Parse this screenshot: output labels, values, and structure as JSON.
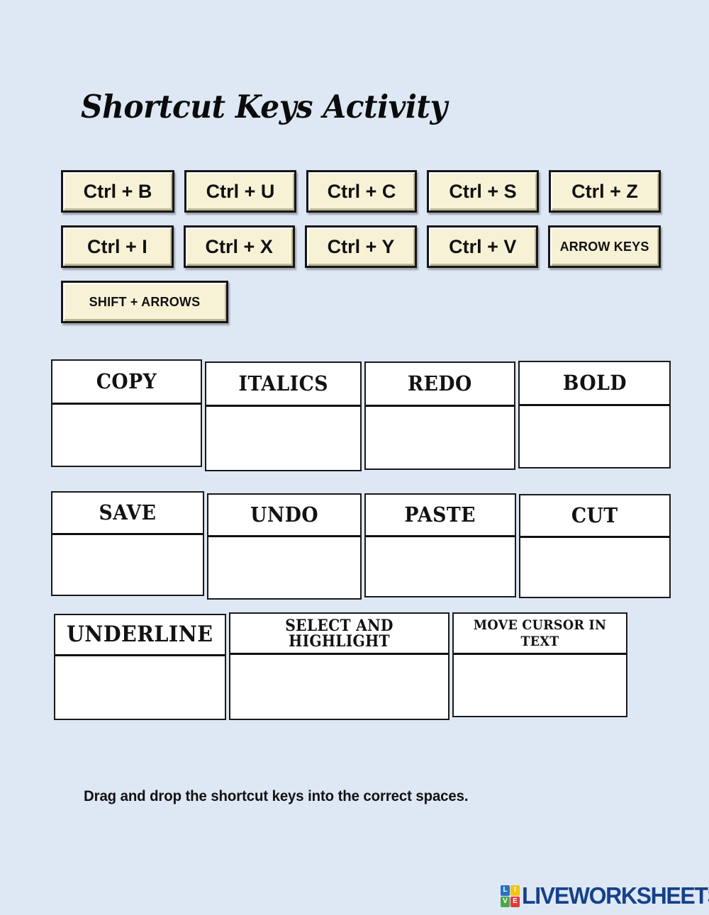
{
  "page": {
    "title": "Shortcut Keys Activity",
    "background_color": "#dee8f4"
  },
  "key_buttons": {
    "rows": [
      [
        {
          "label": "Ctrl + B",
          "size": "large"
        },
        {
          "label": "Ctrl + U",
          "size": "large"
        },
        {
          "label": "Ctrl + C",
          "size": "large"
        },
        {
          "label": "Ctrl + S",
          "size": "large"
        },
        {
          "label": "Ctrl + Z",
          "size": "large"
        }
      ],
      [
        {
          "label": "Ctrl + I",
          "size": "large"
        },
        {
          "label": "Ctrl + X",
          "size": "large"
        },
        {
          "label": "Ctrl + Y",
          "size": "large"
        },
        {
          "label": "Ctrl + V",
          "size": "large"
        },
        {
          "label": "ARROW KEYS",
          "size": "small"
        }
      ],
      [
        {
          "label": "SHIFT + ARROWS",
          "size": "small"
        }
      ]
    ],
    "face_color": "#f7f2d6",
    "border_color": "#161616"
  },
  "answer_rows": [
    {
      "boxes": [
        {
          "header": "COPY",
          "answer": ""
        },
        {
          "header": "ITALICS",
          "answer": ""
        },
        {
          "header": "REDO",
          "answer": ""
        },
        {
          "header": "BOLD",
          "answer": ""
        }
      ]
    },
    {
      "boxes": [
        {
          "header": "SAVE",
          "answer": ""
        },
        {
          "header": "UNDO",
          "answer": ""
        },
        {
          "header": "PASTE",
          "answer": ""
        },
        {
          "header": "CUT",
          "answer": ""
        }
      ]
    },
    {
      "boxes": [
        {
          "header": "UNDERLINE",
          "answer": ""
        },
        {
          "header": "SELECT AND HIGHLIGHT",
          "answer": ""
        },
        {
          "header": "MOVE CURSOR IN TEXT",
          "answer": ""
        }
      ]
    }
  ],
  "instruction": "Drag and drop the shortcut keys into the correct spaces.",
  "logo": {
    "tiles": [
      {
        "letter": "L",
        "color": "#2d6fc4"
      },
      {
        "letter": "I",
        "color": "#f2c515"
      },
      {
        "letter": "V",
        "color": "#49a84a"
      },
      {
        "letter": "E",
        "color": "#e03a3a"
      }
    ],
    "wordmark": "LIVEWORKSHEETS",
    "wordmark_color": "#16418a"
  }
}
